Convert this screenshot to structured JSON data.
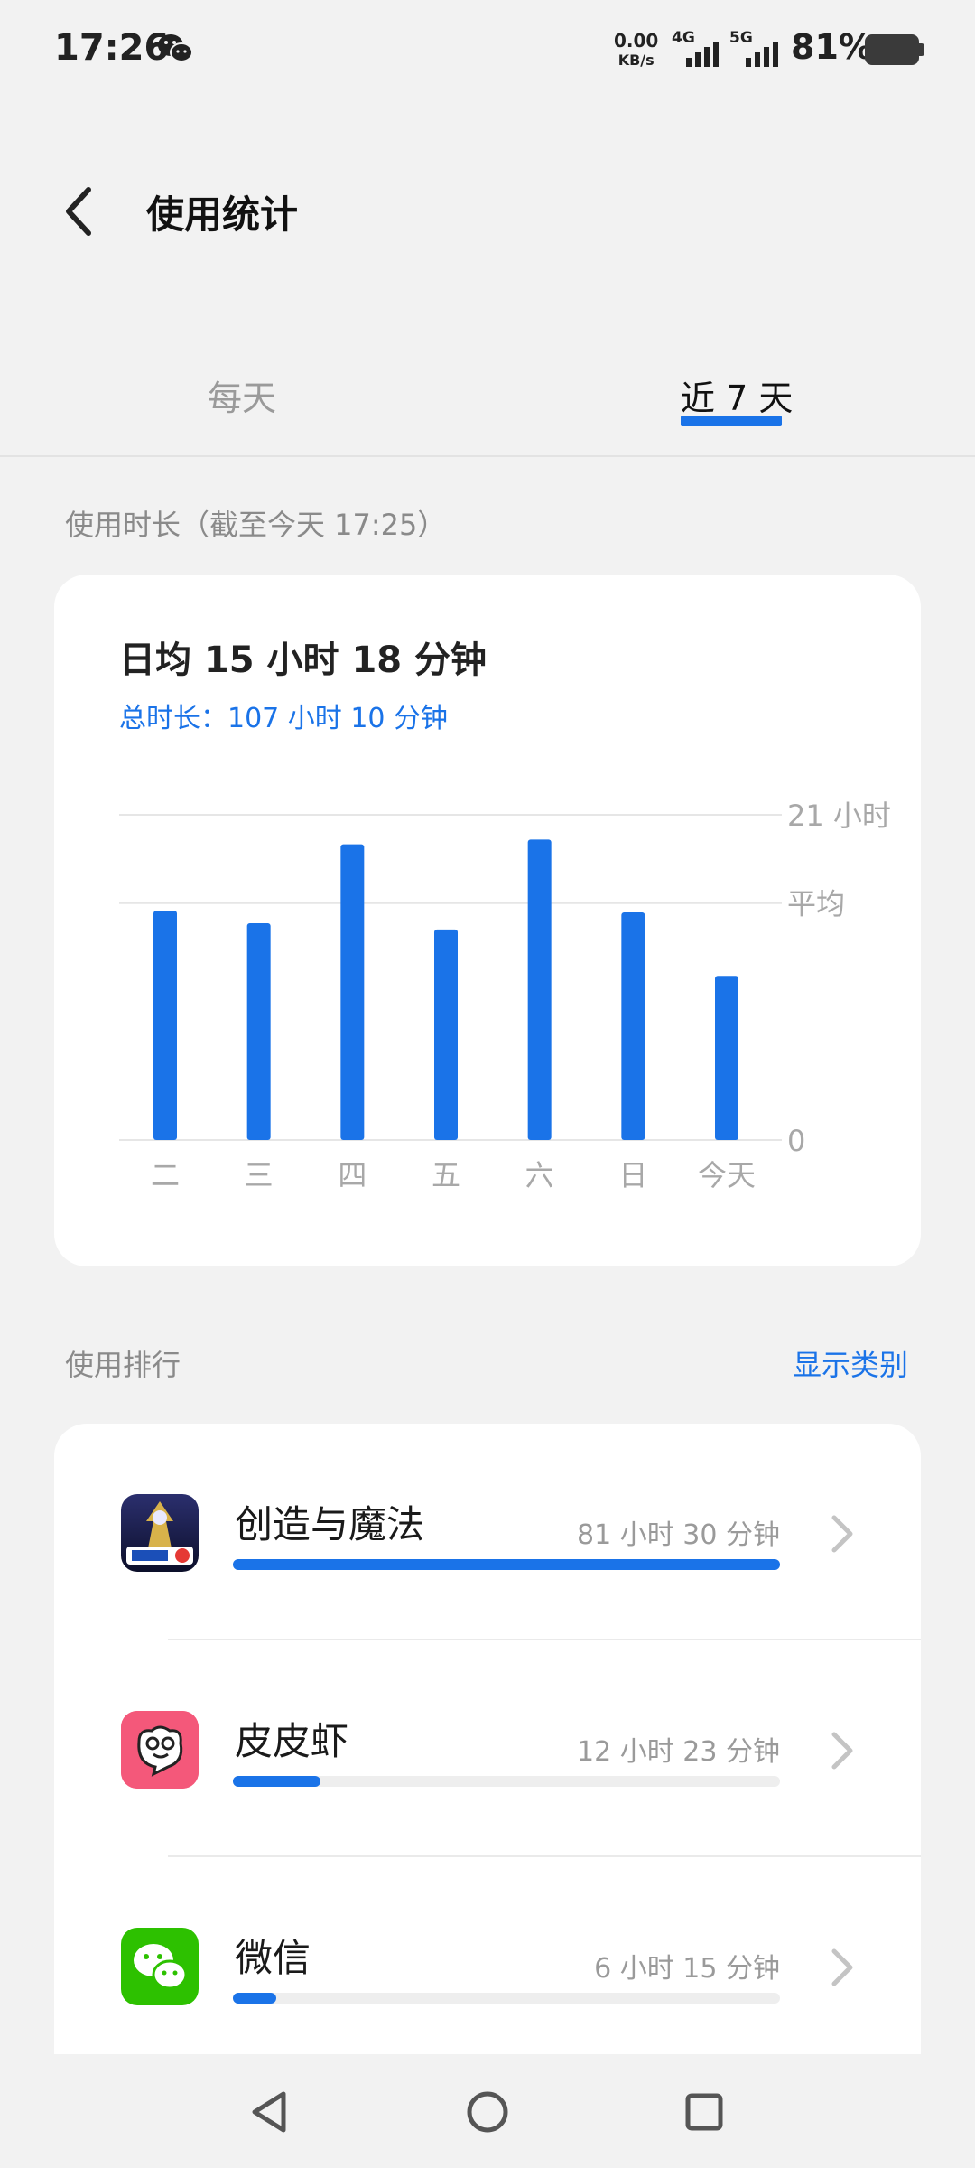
{
  "status_bar": {
    "time": "17:26",
    "net_speed_value": "0.00",
    "net_speed_unit": "KB/s",
    "signal_1": "4G",
    "signal_2": "5G",
    "battery": "81%",
    "notification_icon": "wechat-icon"
  },
  "header": {
    "title": "使用统计",
    "back_icon": "back-arrow-icon"
  },
  "tabs": [
    {
      "label": "每天",
      "selected": false
    },
    {
      "label": "近 7 天",
      "selected": true
    }
  ],
  "usage": {
    "section_label": "使用时长（截至今天 17:25）",
    "daily_average": "日均 15 小时 18 分钟",
    "total": "总时长：107 小时 10 分钟"
  },
  "chart_data": {
    "type": "bar",
    "categories": [
      "二",
      "三",
      "四",
      "五",
      "六",
      "日",
      "今天"
    ],
    "values": [
      14.8,
      14.0,
      19.1,
      13.6,
      19.4,
      14.7,
      10.6
    ],
    "unit": "小时",
    "ylim": [
      0,
      21
    ],
    "y_ticks": [
      {
        "value": 21,
        "label": "21 小时"
      },
      {
        "value": 15.3,
        "label": "平均"
      },
      {
        "value": 0,
        "label": "0"
      }
    ],
    "bar_color": "#1a73e8",
    "grid": true
  },
  "ranking": {
    "section_label": "使用排行",
    "show_category": "显示类别",
    "apps": [
      {
        "name": "创造与魔法",
        "time": "81 小时 30 分钟",
        "fraction": 1.0,
        "icon": "game-app-icon"
      },
      {
        "name": "皮皮虾",
        "time": "12 小时 23 分钟",
        "fraction": 0.16,
        "icon": "pipixia-app-icon"
      },
      {
        "name": "微信",
        "time": "6 小时 15 分钟",
        "fraction": 0.08,
        "icon": "wechat-app-icon"
      }
    ]
  },
  "navbar": {
    "buttons": [
      "back-triangle-icon",
      "home-circle-icon",
      "recents-square-icon"
    ]
  },
  "colors": {
    "accent": "#1a73e8",
    "background": "#f2f2f2",
    "card": "#ffffff"
  }
}
